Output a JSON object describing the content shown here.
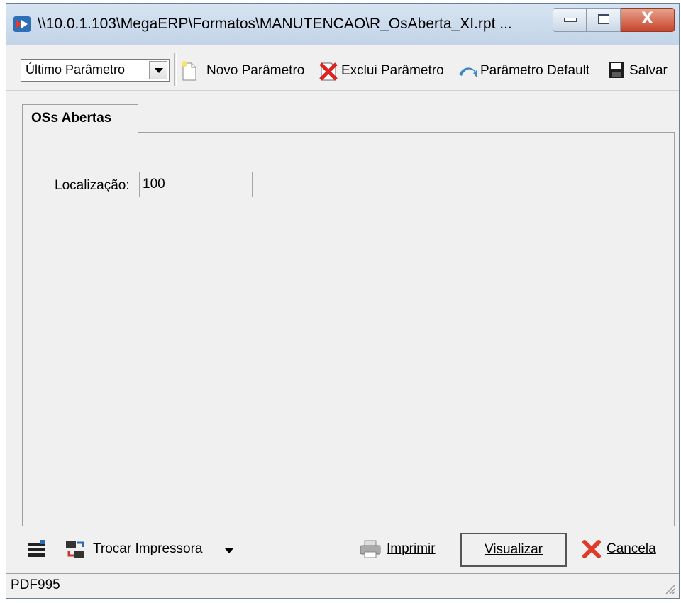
{
  "window": {
    "title": "\\\\10.0.1.103\\MegaERP\\Formatos\\MANUTENCAO\\R_OsAberta_XI.rpt ...",
    "icon": "app-icon",
    "controls": {
      "close_glyph": "X"
    }
  },
  "toolbar": {
    "param_select": {
      "value": "Último Parâmetro"
    },
    "new_param_label": "Novo Parâmetro",
    "delete_param_label": "Exclui Parâmetro",
    "default_param_label": "Parâmetro Default",
    "save_label": "Salvar"
  },
  "tabs": [
    {
      "label": "OSs Abertas",
      "active": true
    }
  ],
  "form": {
    "localizacao_label": "Localização:",
    "localizacao_value": "100"
  },
  "bottom": {
    "change_printer_label": "Trocar Impressora",
    "print_label": "Imprimir",
    "preview_label": "Visualizar",
    "cancel_label": "Cancela"
  },
  "status": {
    "printer": "PDF995"
  },
  "colors": {
    "accent": "#c8452b",
    "titlebar": "#c3d4e8"
  }
}
